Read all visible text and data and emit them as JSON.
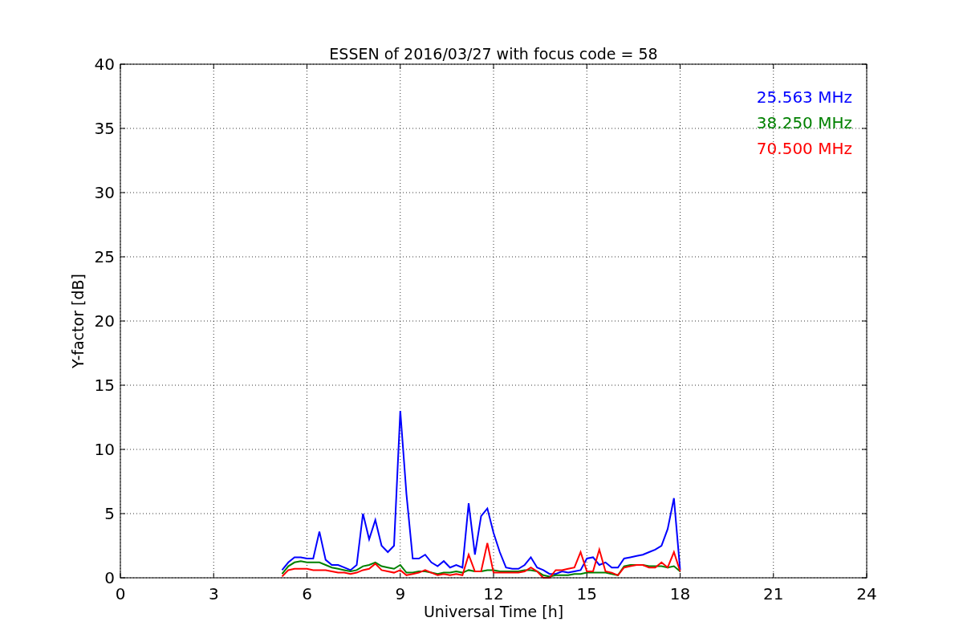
{
  "chart_data": {
    "type": "line",
    "title": "ESSEN of 2016/03/27 with focus code = 58",
    "xlabel": "Universal Time [h]",
    "ylabel": "Y-factor [dB]",
    "grid": true,
    "xlim": [
      0,
      24
    ],
    "ylim": [
      0,
      40
    ],
    "xticks": [
      0,
      3,
      6,
      9,
      12,
      15,
      18,
      21,
      24
    ],
    "yticks": [
      0,
      5,
      10,
      15,
      20,
      25,
      30,
      35,
      40
    ],
    "x": [
      5.2,
      5.4,
      5.6,
      5.8,
      6.0,
      6.2,
      6.4,
      6.6,
      6.8,
      7.0,
      7.2,
      7.4,
      7.6,
      7.8,
      8.0,
      8.2,
      8.4,
      8.6,
      8.8,
      9.0,
      9.2,
      9.4,
      9.6,
      9.8,
      10.0,
      10.2,
      10.4,
      10.6,
      10.8,
      11.0,
      11.2,
      11.4,
      11.6,
      11.8,
      12.0,
      12.2,
      12.4,
      12.6,
      12.8,
      13.0,
      13.2,
      13.4,
      13.6,
      13.8,
      14.0,
      14.2,
      14.4,
      14.6,
      14.8,
      15.0,
      15.2,
      15.4,
      15.6,
      15.8,
      16.0,
      16.2,
      16.4,
      16.6,
      16.8,
      17.0,
      17.2,
      17.4,
      17.6,
      17.8,
      18.0
    ],
    "series": [
      {
        "name": "25.563 MHz",
        "color": "#0000ff",
        "values": [
          0.6,
          1.2,
          1.6,
          1.6,
          1.5,
          1.5,
          3.6,
          1.4,
          1.0,
          1.0,
          0.8,
          0.6,
          1.0,
          5.0,
          3.0,
          4.5,
          2.5,
          2.0,
          2.5,
          13.0,
          6.5,
          1.5,
          1.5,
          1.8,
          1.2,
          0.9,
          1.3,
          0.8,
          1.0,
          0.8,
          5.8,
          1.8,
          4.8,
          5.4,
          3.5,
          2.0,
          0.8,
          0.7,
          0.7,
          1.0,
          1.6,
          0.8,
          0.6,
          0.3,
          0.3,
          0.5,
          0.4,
          0.5,
          0.6,
          1.5,
          1.6,
          1.0,
          1.2,
          0.8,
          0.8,
          1.5,
          1.6,
          1.7,
          1.8,
          2.0,
          2.2,
          2.5,
          3.8,
          6.2,
          0.6
        ]
      },
      {
        "name": "38.250 MHz",
        "color": "#008000",
        "values": [
          0.3,
          0.9,
          1.2,
          1.3,
          1.2,
          1.2,
          1.2,
          1.0,
          0.8,
          0.7,
          0.6,
          0.5,
          0.6,
          0.9,
          1.0,
          1.2,
          0.9,
          0.8,
          0.7,
          1.0,
          0.4,
          0.4,
          0.5,
          0.5,
          0.4,
          0.3,
          0.4,
          0.4,
          0.5,
          0.4,
          0.6,
          0.5,
          0.5,
          0.6,
          0.6,
          0.5,
          0.5,
          0.5,
          0.5,
          0.6,
          0.6,
          0.5,
          0.2,
          0.1,
          0.2,
          0.2,
          0.2,
          0.3,
          0.3,
          0.4,
          0.4,
          0.4,
          0.4,
          0.3,
          0.2,
          0.9,
          1.0,
          1.0,
          1.0,
          0.9,
          0.9,
          0.9,
          0.8,
          0.9,
          0.5
        ]
      },
      {
        "name": "70.500 MHz",
        "color": "#ff0000",
        "values": [
          0.1,
          0.6,
          0.7,
          0.7,
          0.7,
          0.6,
          0.6,
          0.6,
          0.5,
          0.4,
          0.4,
          0.3,
          0.4,
          0.6,
          0.7,
          1.1,
          0.6,
          0.5,
          0.4,
          0.6,
          0.2,
          0.3,
          0.4,
          0.6,
          0.4,
          0.2,
          0.3,
          0.2,
          0.3,
          0.2,
          1.8,
          0.5,
          0.5,
          2.7,
          0.4,
          0.4,
          0.4,
          0.4,
          0.4,
          0.5,
          0.8,
          0.5,
          0.0,
          0.0,
          0.6,
          0.6,
          0.7,
          0.8,
          2.0,
          0.5,
          0.5,
          2.2,
          0.5,
          0.4,
          0.2,
          0.8,
          0.9,
          1.0,
          1.0,
          0.8,
          0.8,
          1.2,
          0.8,
          2.0,
          0.5
        ]
      }
    ]
  }
}
